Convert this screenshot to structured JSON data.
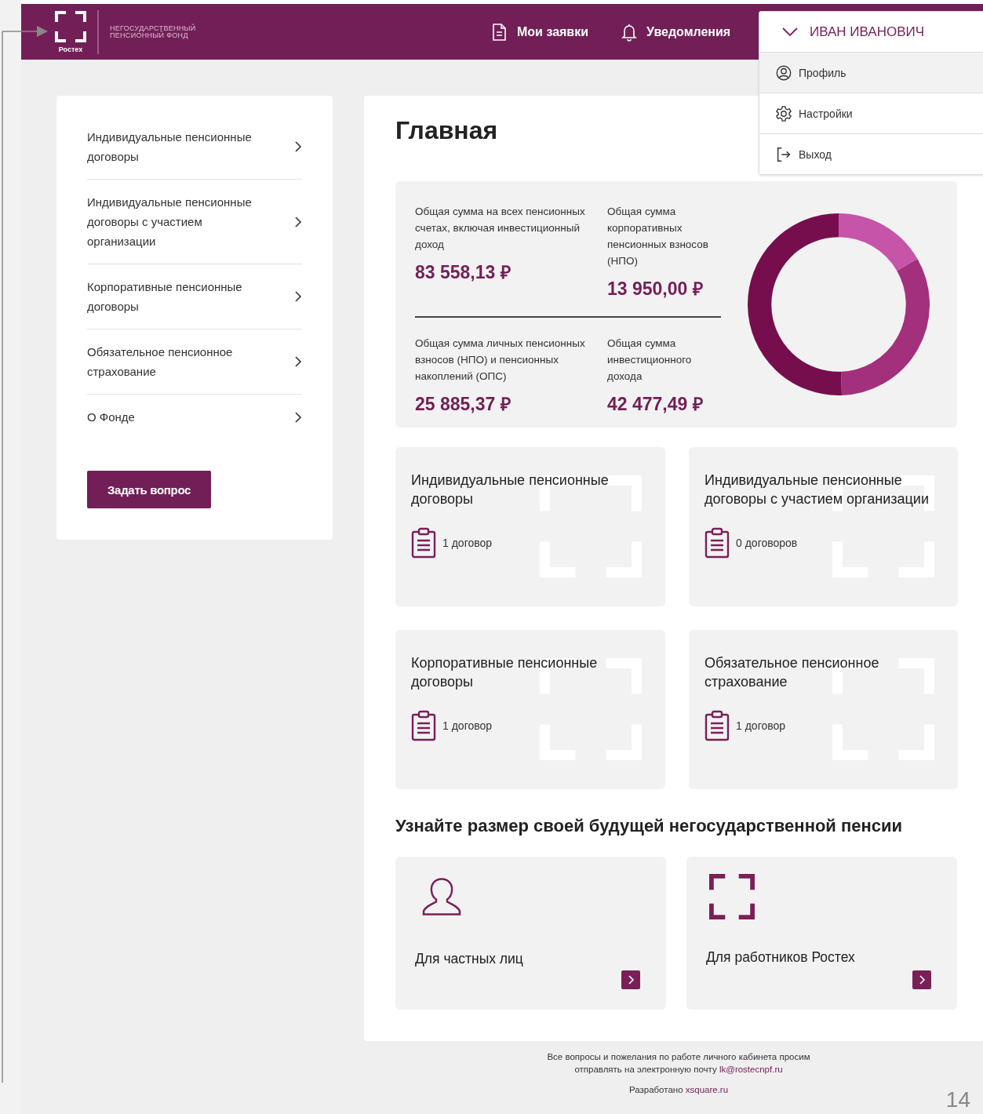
{
  "header": {
    "logo_caption": "Ростех",
    "org_name": "НЕГОСУДАРСТВЕННЫЙ ПЕНСИОННЫЙ ФОНД",
    "nav": [
      {
        "label": "Мои заявки"
      },
      {
        "label": "Уведомления"
      }
    ],
    "user_menu": {
      "name": "ИВАН ИВАНОВИЧ",
      "expanded": true,
      "items": [
        {
          "label": "Профиль",
          "selected": true
        },
        {
          "label": "Настройки",
          "selected": false
        },
        {
          "label": "Выход",
          "selected": false
        }
      ]
    }
  },
  "sidebar": {
    "items": [
      {
        "label": "Индивидуальные пенсионные договоры"
      },
      {
        "label": "Индивидуальные пенсионные договоры с участием организации"
      },
      {
        "label": "Корпоративные пенсионные договоры"
      },
      {
        "label": "Обязательное пенсионное страхование"
      },
      {
        "label": "О Фонде"
      }
    ],
    "button": "Задать вопрос"
  },
  "main": {
    "title": "Главная",
    "summary": [
      {
        "label": "Общая сумма на всех пенсионных счетах, включая инвестиционный доход",
        "amount": "83 558,13 ₽"
      },
      {
        "label": "Общая сумма корпоративных пенсионных взносов (НПО)",
        "amount": "13 950,00 ₽"
      },
      {
        "label": "Общая сумма личных пенсионных взносов (НПО) и пенсионных накоплений (ОПС)",
        "amount": "25 885,37 ₽"
      },
      {
        "label": "Общая сумма инвестиционного дохода",
        "amount": "42 477,49 ₽"
      }
    ],
    "product_cards": [
      {
        "title": "Индивидуальные пенсионные договоры",
        "count": "1 договор"
      },
      {
        "title": "Индивидуальные пенсионные договоры с участием организации",
        "count": "0 договоров"
      },
      {
        "title": "Корпоративные пенсионные договоры",
        "count": "1 договор"
      },
      {
        "title": "Обязательное пенсионное страхование",
        "count": "1 договор"
      }
    ],
    "calc_title": "Узнайте размер своей будущей негосударственной пенсии",
    "calc_cards": [
      {
        "label": "Для частных лиц",
        "kind": "person"
      },
      {
        "label": "Для работников Ростех",
        "kind": "logo"
      }
    ]
  },
  "footer": {
    "note": "Все вопросы и пожелания по работе личного кабинета просим отправлять на электронную почту ",
    "email": "lk@rostecnpf.ru",
    "credit": "Разработано ",
    "credit_link": "xsquare.ru"
  },
  "slide": {
    "page_number": "14"
  }
}
